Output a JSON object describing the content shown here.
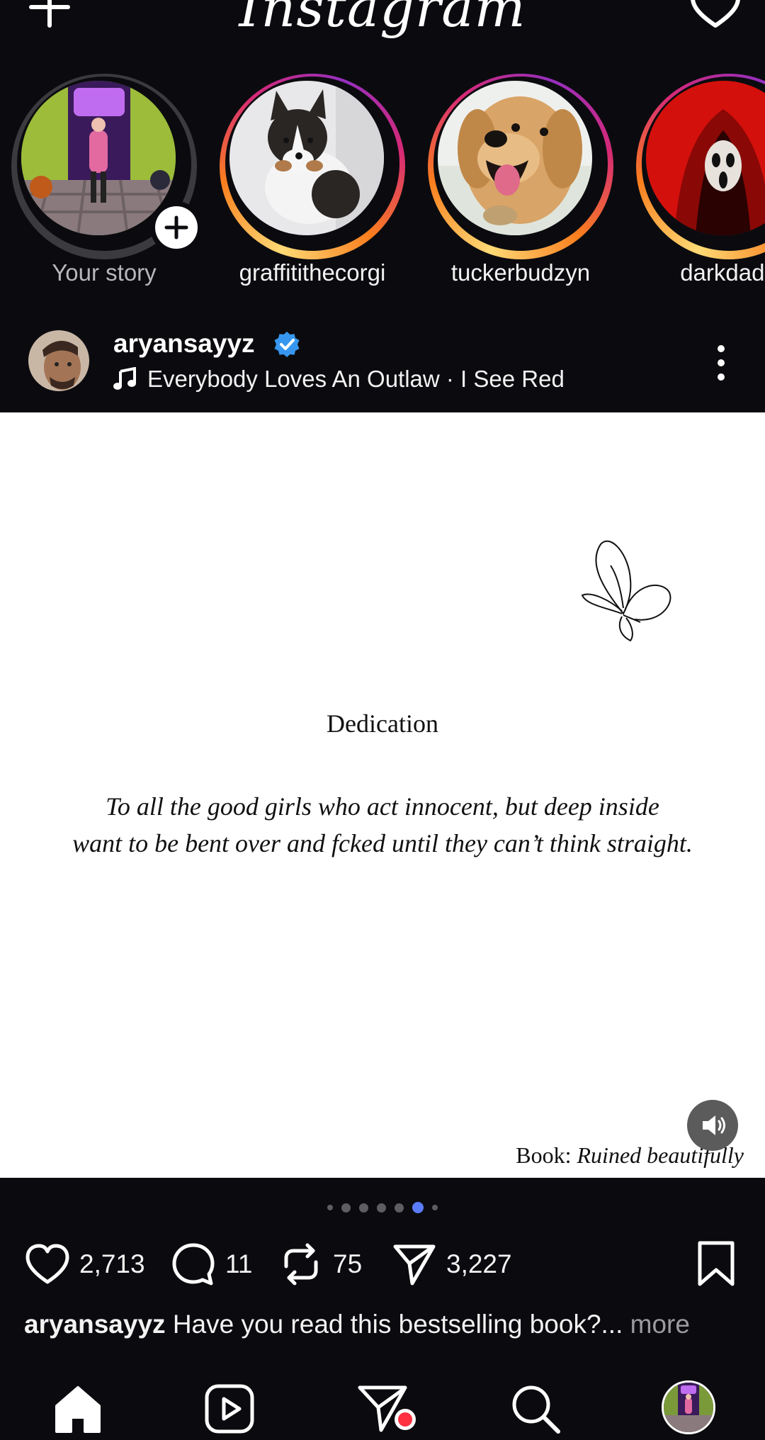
{
  "app": {
    "brand": "Instagram"
  },
  "stories": [
    {
      "name": "Your story",
      "own": true,
      "seen": true
    },
    {
      "name": "graffitithecorgi",
      "own": false,
      "seen": false
    },
    {
      "name": "tuckerbudzyn",
      "own": false,
      "seen": false
    },
    {
      "name": "darkdadd",
      "own": false,
      "seen": false
    }
  ],
  "post": {
    "username": "aryansayyz",
    "verified": true,
    "audio": "Everybody Loves An Outlaw · I See Red",
    "image": {
      "title": "Dedication",
      "dedication_line1": "To all the good girls who act innocent, but deep inside",
      "dedication_line2": "want to be bent over and fcked until they can’t think straight.",
      "book_prefix": "Book:",
      "book_title": "Ruined beautifully"
    },
    "carousel": {
      "count": 7,
      "active_index": 5
    },
    "likes": "2,713",
    "comments": "11",
    "reposts": "75",
    "shares": "3,227",
    "caption_user": "aryansayyz",
    "caption_text": "Have you read this bestselling book?...",
    "caption_more": "more"
  },
  "colors": {
    "background": "#0b0b0f",
    "accent_blue": "#3797f0",
    "pager_active": "#5b7cfa",
    "notification_red": "#ff3040"
  },
  "icons": {
    "top_left": "plus-icon",
    "top_right": "heart-icon",
    "nav": [
      "home-icon",
      "reels-icon",
      "direct-message-icon",
      "search-icon",
      "profile-avatar"
    ]
  }
}
